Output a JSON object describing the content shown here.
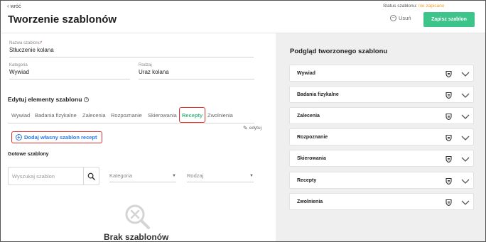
{
  "header": {
    "back_label": "wróć",
    "title": "Tworzenie szablonów",
    "status_label": "Status szablonu:",
    "status_value": "nie zapisano",
    "delete_label": "Usuń",
    "save_label": "Zapisz szablon"
  },
  "form": {
    "name": {
      "label": "Nazwa szablonu",
      "required": "*",
      "value": "Stłuczenie kolana"
    },
    "category": {
      "label": "Kategoria",
      "value": "Wywiad"
    },
    "kind": {
      "label": "Rodzaj",
      "value": "Uraz kolana"
    }
  },
  "editor": {
    "section_title": "Edytuj elementy szablonu",
    "tabs": [
      "Wywiad",
      "Badania fizykalne",
      "Zalecenia",
      "Rozpoznanie",
      "Skierowania",
      "Recepty",
      "Zwolnienia"
    ],
    "active_tab": "Recepty",
    "edit_label": "edytuj",
    "add_button_label": "Dodaj własny szablon recept"
  },
  "ready": {
    "title": "Gotowe szablony",
    "search_placeholder": "Wyszukaj szablon",
    "category_placeholder": "Kategoria",
    "kind_placeholder": "Rodzaj",
    "empty_text": "Brak szablonów"
  },
  "preview": {
    "title": "Podgląd tworzonego szablonu",
    "items": [
      "Wywiad",
      "Badania fizykalne",
      "Zalecenia",
      "Rozpoznanie",
      "Skierowania",
      "Recepty",
      "Zwolnienia"
    ]
  },
  "colors": {
    "accent_green": "#3cc48a",
    "status_orange": "#f0a020",
    "highlight_red": "#e53030",
    "link_blue": "#2d7ae0"
  },
  "icons": {
    "back": "chevron-left-icon",
    "delete": "minus-circle-icon",
    "info": "info-icon",
    "edit": "pencil-icon",
    "add": "plus-circle-icon",
    "search": "search-icon",
    "dropdown": "caret-down-icon",
    "empty": "search-x-icon",
    "card_badge": "shield-icon",
    "card_expand": "chevron-down-icon"
  }
}
